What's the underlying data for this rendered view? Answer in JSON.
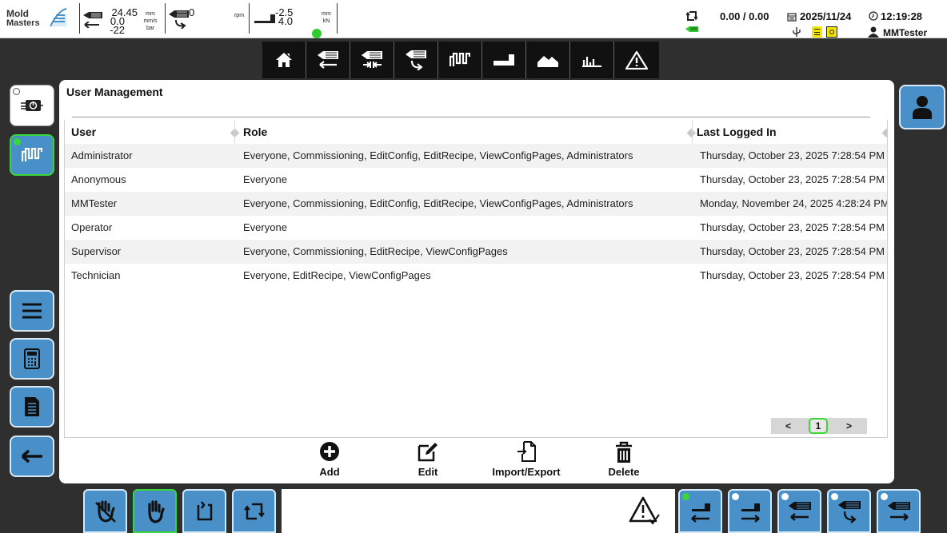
{
  "brand": {
    "logo_line1": "Mold",
    "logo_line2": "Masters"
  },
  "status": {
    "inj_pos": "24.45",
    "inj_vel": "0.0",
    "inj_press": "-22",
    "unit_mm": "mm",
    "unit_mms": "mm/s",
    "unit_bar": "bar",
    "screw_rpm": "0",
    "unit_rpm": "rpm",
    "clamp_pos": "-2.5",
    "clamp_force": "4.0",
    "unit_mm2": "mm",
    "unit_kn": "kN",
    "cycle_values": "0.00 / 0.00",
    "date": "2025/11/24",
    "time": "12:19:28",
    "user": "MMTester"
  },
  "page": {
    "title": "User Management"
  },
  "table": {
    "headers": {
      "user": "User",
      "role": "Role",
      "last": "Last Logged In"
    },
    "rows": [
      {
        "user": "Administrator",
        "role": "Everyone, Commissioning, EditConfig, EditRecipe, ViewConfigPages, Administrators",
        "last": "Thursday, October 23, 2025 7:28:54 PM"
      },
      {
        "user": "Anonymous",
        "role": "Everyone",
        "last": "Thursday, October 23, 2025 7:28:54 PM"
      },
      {
        "user": "MMTester",
        "role": "Everyone, Commissioning, EditConfig, EditRecipe, ViewConfigPages, Administrators",
        "last": "Monday, November 24, 2025 4:28:24 PM"
      },
      {
        "user": "Operator",
        "role": "Everyone",
        "last": "Thursday, October 23, 2025 7:28:54 PM"
      },
      {
        "user": "Supervisor",
        "role": "Everyone, Commissioning, EditRecipe, ViewConfigPages",
        "last": "Thursday, October 23, 2025 7:28:54 PM"
      },
      {
        "user": "Technician",
        "role": "Everyone, EditRecipe, ViewConfigPages",
        "last": "Thursday, October 23, 2025 7:28:54 PM"
      }
    ]
  },
  "pager": {
    "prev": "<",
    "current": "1",
    "next": ">"
  },
  "actions": {
    "add": "Add",
    "edit": "Edit",
    "import_export": "Import/Export",
    "delete": "Delete"
  },
  "icons": {
    "toolbar": [
      "home-icon",
      "injection-icon",
      "hold-icon",
      "screw-icon",
      "temperature-icon",
      "clamp-icon",
      "profile-icon",
      "statistics-icon",
      "alarm-icon"
    ],
    "left_side": [
      "power-icon",
      "temperature-icon",
      "menu-icon",
      "calculator-icon",
      "document-icon",
      "back-icon"
    ],
    "bottom_left": [
      "manual-icon",
      "hand-icon",
      "semi-auto-icon",
      "auto-cycle-icon"
    ],
    "bottom_right": [
      "clamp-close-icon",
      "clamp-open-icon",
      "injection-back-icon",
      "screw-recover-icon",
      "injection-forward-icon"
    ]
  },
  "colors": {
    "button_blue": "#4a90c8",
    "active_green": "#38d838",
    "status_yellow": "#f2e600",
    "toolbar_black": "#111111"
  }
}
